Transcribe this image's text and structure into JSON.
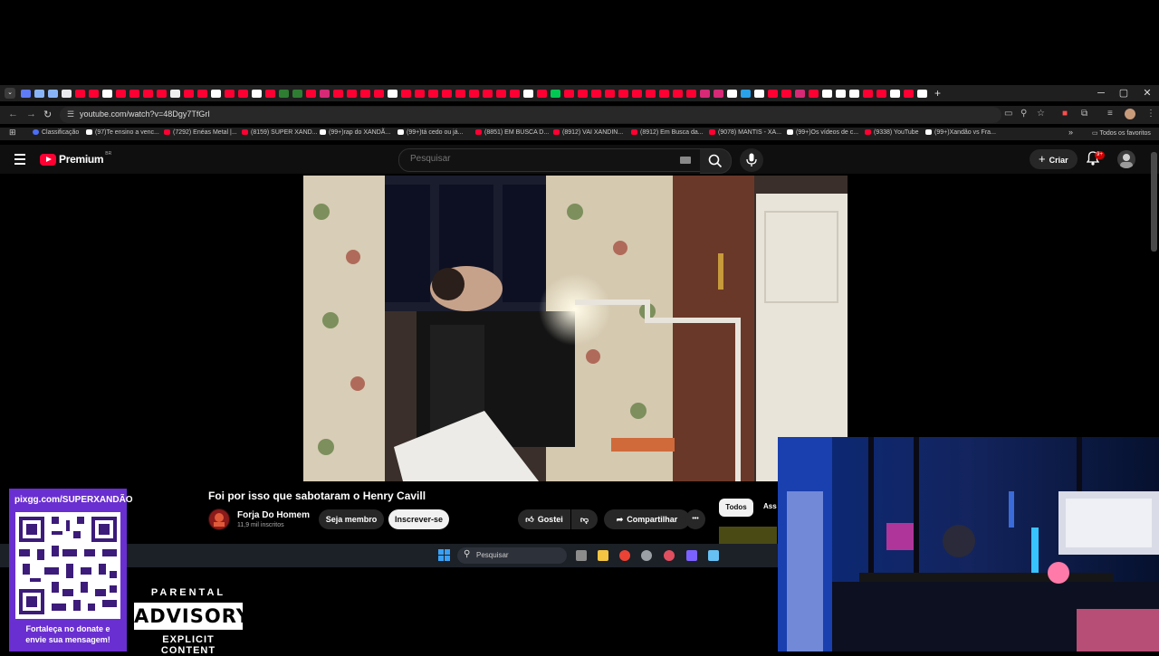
{
  "browser": {
    "tab_colors": [
      "#5f7bf5",
      "#8ab4f8",
      "#8ab4f8",
      "#e8eaed",
      "#ff0033",
      "#ff0033",
      "#ffffff",
      "#ff0033",
      "#ff0033",
      "#ff0033",
      "#ff0033",
      "#eeeeee",
      "#ff0033",
      "#ff0033",
      "#ffffff",
      "#ff0033",
      "#ff0033",
      "#ffffff",
      "#ff0033",
      "#2e7d32",
      "#2e7d32",
      "#ff0033",
      "#d62976",
      "#ff0033",
      "#ff0033",
      "#ff0033",
      "#ff0033",
      "#ffffff",
      "#ff0033",
      "#ff0033",
      "#ff0033",
      "#ff0033",
      "#ff0033",
      "#ff0033",
      "#ff0033",
      "#ff0033",
      "#ff0033",
      "#ffffff",
      "#ff0033",
      "#00c853",
      "#ff0033",
      "#ff0033",
      "#ff0033",
      "#ff0033",
      "#ff0033",
      "#ff0033",
      "#ff0033",
      "#ff0033",
      "#ff0033",
      "#ff0033",
      "#d62976",
      "#d62976",
      "#ffffff",
      "#2aa1e8",
      "#ffffff",
      "#ff0033",
      "#ff0033",
      "#d62976",
      "#ff0033",
      "#ffffff",
      "#ffffff",
      "#ffffff",
      "#ff0033",
      "#ff0033",
      "#ffffff",
      "#ff0033",
      "#ffffff"
    ],
    "new_tab": "+",
    "minimize": "─",
    "maximize": "▢",
    "close": "✕",
    "url": "youtube.com/watch?v=48Dgy7TfGrI",
    "bookmarks": [
      "Classificação",
      "(97)Te ensino a venc...",
      "(7292) Enéas Metal |...",
      "(8159) SUPER XAND...",
      "(99+)rap do XANDÃ...",
      "(99+)tá cedo ou já...",
      "(8851) EM BUSCA D...",
      "(8912) VAI XANDIN...",
      "(8912) Em Busca da...",
      "(9078) MANTIS - XA...",
      "(99+)Os vídeos de c...",
      "(9338) YouTube",
      "(99+)Xandão vs Fra..."
    ],
    "bookmarks_overflow": "»",
    "all_bookmarks": "Todos os favoritos"
  },
  "youtube": {
    "logo_text": "Premium",
    "logo_region": "BR",
    "search_placeholder": "Pesquisar",
    "create_label": "Criar",
    "notifications_badge": "9+",
    "video": {
      "title": "Foi por isso que sabotaram o Henry Cavill",
      "channel": "Forja Do Homem",
      "subscribers": "11,9 mil inscritos",
      "member_label": "Seja membro",
      "subscribe_label": "Inscrever-se",
      "like_label": "Gostei",
      "share_label": "Compartilhar",
      "more_label": "•••"
    },
    "chips": {
      "all": "Todos",
      "next_partial": "Ass"
    }
  },
  "taskbar": {
    "search_label": "Pesquisar",
    "app_colors": [
      "#8c8c8c",
      "#f4c542",
      "#ea4335",
      "#9aa0a6",
      "#e04f5f",
      "#7b61ff",
      "#66c0f4"
    ]
  },
  "overlay": {
    "qr_url": "pixgg.com/SUPERXANDÃO",
    "qr_caption_line1": "Fortaleça no donate e",
    "qr_caption_line2": "envie sua mensagem!",
    "advisory_top": "PARENTAL",
    "advisory_mid": "ADVISORY",
    "advisory_bottom": "EXPLICIT CONTENT"
  }
}
